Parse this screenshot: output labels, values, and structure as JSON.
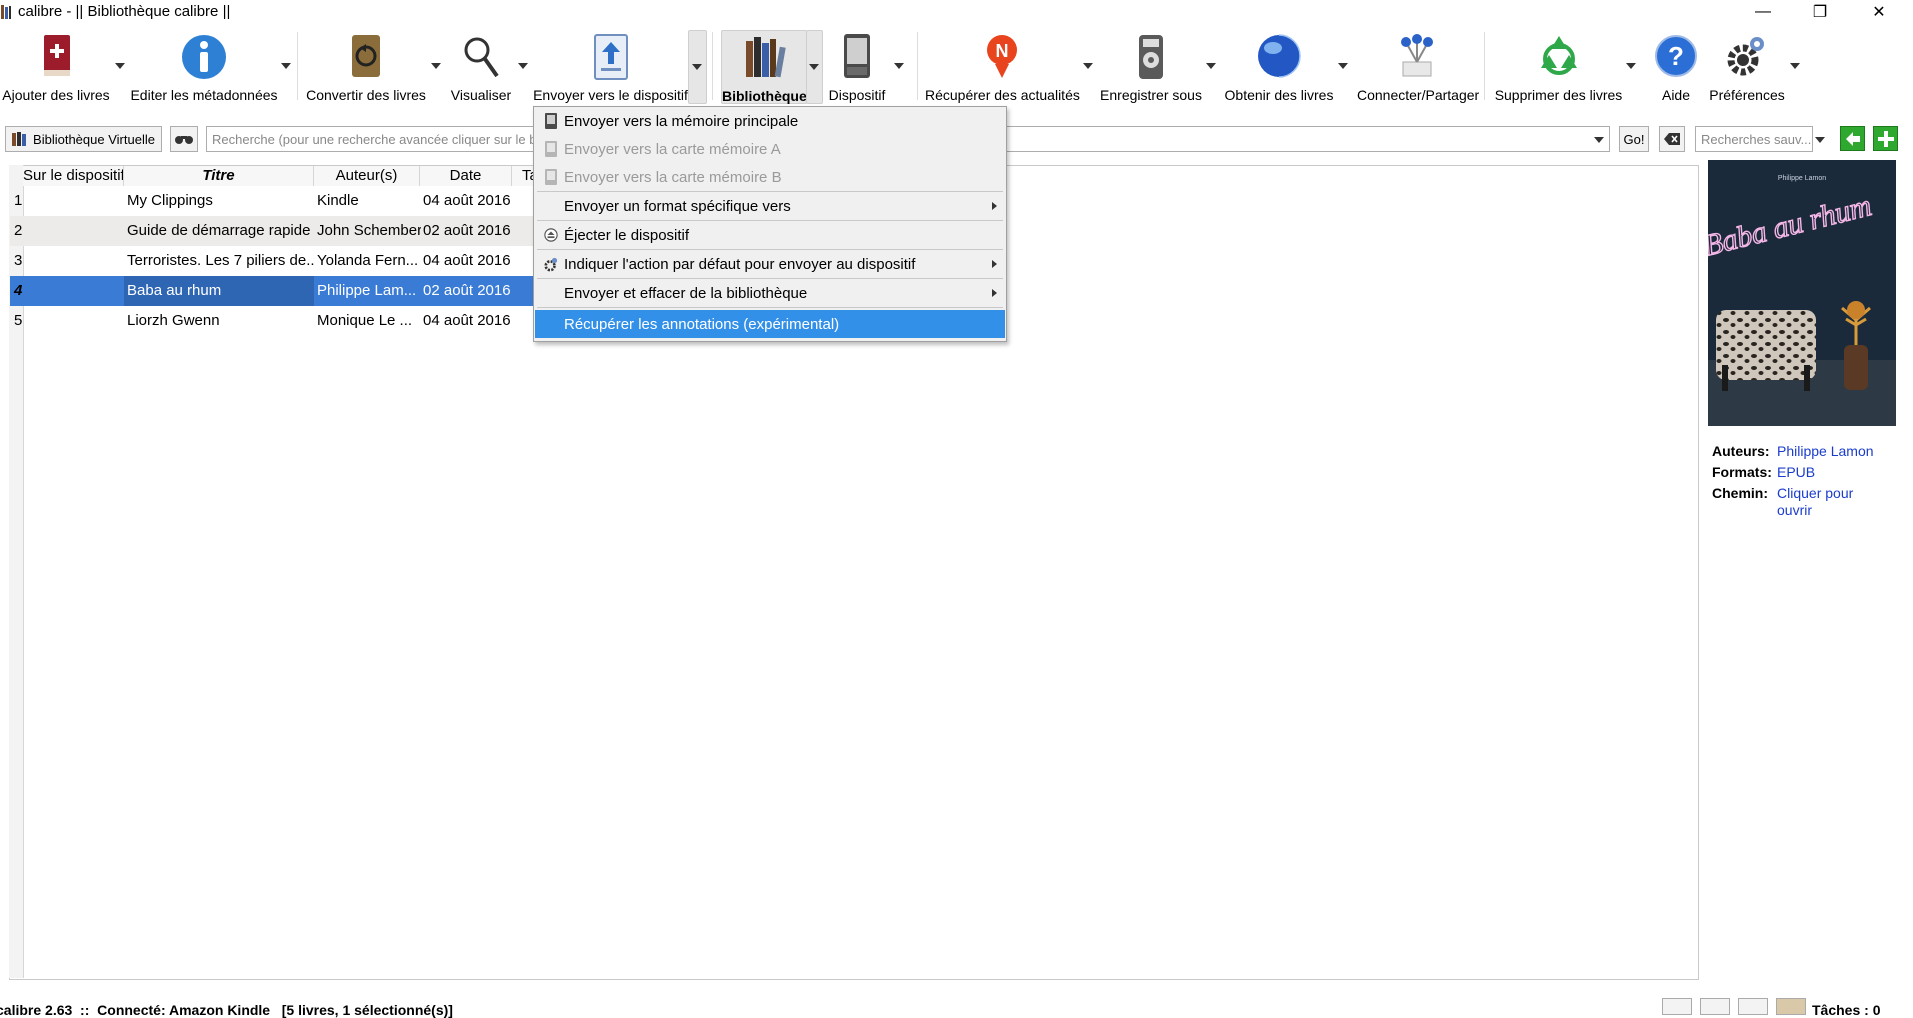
{
  "window": {
    "title": "calibre - || Bibliothèque calibre ||"
  },
  "toolbar": {
    "items": [
      {
        "label": "Ajouter des livres",
        "icon": "add-book-icon"
      },
      {
        "label": "Editer les métadonnées",
        "icon": "info-icon"
      },
      {
        "label": "Convertir des livres",
        "icon": "convert-icon"
      },
      {
        "label": "Visualiser",
        "icon": "magnifier-icon"
      },
      {
        "label": "Envoyer vers le dispositif",
        "icon": "send-to-device-icon"
      },
      {
        "label": "Bibliothèque",
        "icon": "library-icon"
      },
      {
        "label": "Dispositif",
        "icon": "device-icon"
      },
      {
        "label": "Récupérer des actualités",
        "icon": "news-icon"
      },
      {
        "label": "Enregistrer sous",
        "icon": "save-icon"
      },
      {
        "label": "Obtenir des livres",
        "icon": "globe-icon"
      },
      {
        "label": "Connecter/Partager",
        "icon": "connect-share-icon"
      },
      {
        "label": "Supprimer des livres",
        "icon": "recycle-icon"
      },
      {
        "label": "Aide",
        "icon": "help-icon"
      },
      {
        "label": "Préférences",
        "icon": "gear-icon"
      }
    ]
  },
  "search": {
    "virtual_library": "Bibliothèque Virtuelle",
    "placeholder": "Recherche (pour une recherche avancée cliquer sur le b",
    "go": "Go!",
    "saved_placeholder": "Recherches sauv..."
  },
  "table": {
    "headers": [
      "Sur le dispositif",
      "Titre",
      "Auteur(s)",
      "Date",
      "Ta"
    ],
    "rows": [
      {
        "num": "1",
        "title": "My Clippings",
        "author": "Kindle",
        "date": "04 août 2016"
      },
      {
        "num": "2",
        "title": "Guide de démarrage rapide",
        "author": "John Schember",
        "date": "02 août 2016"
      },
      {
        "num": "3",
        "title": "Terroristes. Les 7 piliers de...",
        "author": "Yolanda Fern...",
        "date": "04 août 2016"
      },
      {
        "num": "4",
        "title": "Baba au rhum",
        "author": "Philippe Lam...",
        "date": "02 août 2016"
      },
      {
        "num": "5",
        "title": "Liorzh Gwenn",
        "author": "Monique Le ...",
        "date": "04 août 2016"
      }
    ],
    "selected_index": 3
  },
  "menu": {
    "items": [
      {
        "label": "Envoyer vers la mémoire principale",
        "disabled": false
      },
      {
        "label": "Envoyer vers la carte mémoire A",
        "disabled": true
      },
      {
        "label": "Envoyer vers la carte mémoire B",
        "disabled": true
      },
      {
        "label": "Envoyer un format spécifique vers",
        "disabled": false
      },
      {
        "label": "Éjecter le dispositif",
        "disabled": false
      },
      {
        "label": "Indiquer l'action par défaut pour envoyer au dispositif",
        "disabled": false
      },
      {
        "label": "Envoyer et effacer de la bibliothèque",
        "disabled": false
      },
      {
        "label": "Récupérer les annotations (expérimental)",
        "disabled": false
      }
    ],
    "highlighted_index": 7
  },
  "details": {
    "cover_author_line": "Philippe Lamon",
    "cover_title": "Baba au rhum",
    "authors_label": "Auteurs:",
    "authors_value": "Philippe Lamon",
    "formats_label": "Formats:",
    "formats_value": "EPUB",
    "path_label": "Chemin:",
    "path_value": "Cliquer pour ouvrir"
  },
  "status": {
    "left": "calibre 2.63  ::  Connecté: Amazon Kindle   [5 livres, 1 sélectionné(s)]",
    "jobs": "Tâches : 0"
  },
  "colors": {
    "accent": "#3390e8",
    "selection": "#3a7bd5",
    "link": "#1a3ccc"
  }
}
